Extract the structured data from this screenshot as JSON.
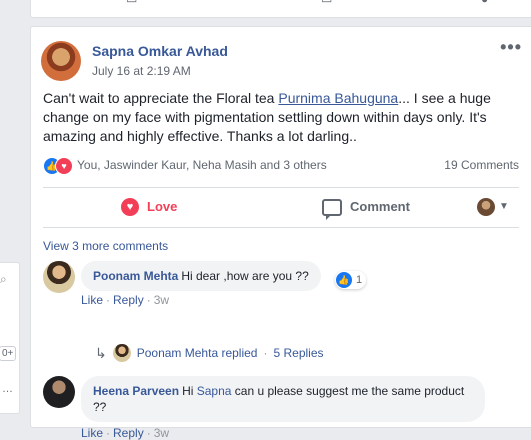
{
  "post": {
    "author": "Sapna Omkar Avhad",
    "time": "July 16 at 2:19 AM",
    "more": "•••",
    "text_before": "Can't wait to appreciate the Floral tea ",
    "mention": "Purnima Bahuguna",
    "text_after": "... I see a huge change on my face with pigmentation settling down within days only. It's amazing and highly effective. Thanks a lot darling..",
    "reaction_names": "You, Jaswinder Kaur, Neha Masih and 3 others",
    "comment_count": "19 Comments",
    "actions": {
      "love": "Love",
      "comment": "Comment"
    }
  },
  "comments": {
    "view_more": "View 3 more comments",
    "items": [
      {
        "name": "Poonam Mehta",
        "text": "Hi dear ,how are you ??",
        "reaction_count": "1",
        "like": "Like",
        "reply": "Reply",
        "time": "3w",
        "replied_name": "Poonam Mehta replied",
        "replies": "5 Replies"
      },
      {
        "name": "Heena Parveen",
        "text_before": "Hi ",
        "mention": "Sapna",
        "text_after": " can u please suggest me the same product ??",
        "like": "Like",
        "reply": "Reply",
        "time": "3w"
      }
    ]
  },
  "colors": {
    "link": "#385898",
    "love": "#f33e58",
    "like": "#1877f2",
    "muted": "#606770"
  },
  "icons": [
    "like-reaction-icon",
    "love-reaction-icon",
    "heart-icon",
    "comment-icon",
    "reply-arrow-icon",
    "search-icon"
  ]
}
